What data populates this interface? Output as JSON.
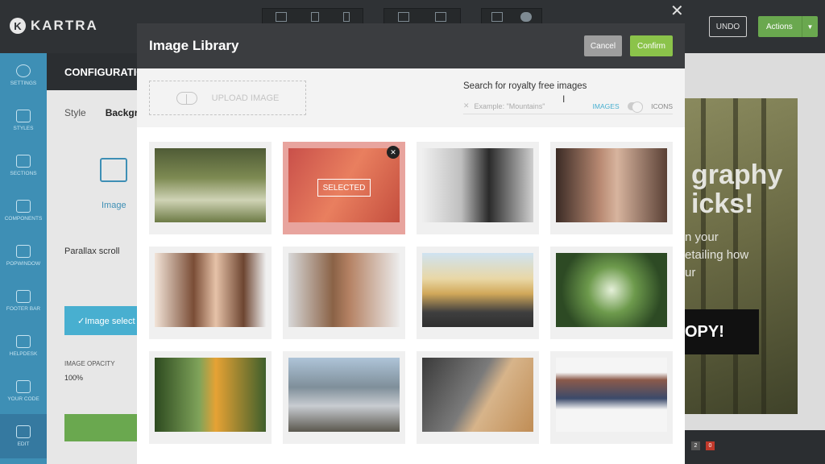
{
  "app": {
    "brand": "KARTRA",
    "undo_label": "UNDO",
    "actions_label": "Actions"
  },
  "left_rail": [
    {
      "label": "SETTINGS",
      "icon": "gear-icon"
    },
    {
      "label": "STYLES",
      "icon": "brush-icon"
    },
    {
      "label": "SECTIONS",
      "icon": "sections-icon"
    },
    {
      "label": "COMPONENTS",
      "icon": "components-icon"
    },
    {
      "label": "POPWINDOW",
      "icon": "popwindow-icon"
    },
    {
      "label": "FOOTER BAR",
      "icon": "footer-bar-icon"
    },
    {
      "label": "HELPDESK",
      "icon": "helpdesk-icon"
    },
    {
      "label": "YOUR CODE",
      "icon": "code-icon"
    },
    {
      "label": "EDIT",
      "icon": "pencil-icon"
    }
  ],
  "config": {
    "title": "CONFIGURATION",
    "tab_style": "Style",
    "tab_background": "Background",
    "image_option": "Image",
    "parallax": "Parallax scroll",
    "image_select_btn": "✓Image select",
    "opacity_label": "IMAGE OPACITY",
    "opacity_value": "100%"
  },
  "modal": {
    "title": "Image Library",
    "cancel": "Cancel",
    "confirm": "Confirm",
    "upload": "UPLOAD IMAGE",
    "search_label": "Search for royalty free images",
    "search_placeholder": "Example: \"Mountains\"",
    "toggle_images": "IMAGES",
    "toggle_icons": "ICONS",
    "selected_label": "SELECTED",
    "images": [
      "forest",
      "canyon",
      "woman-bw",
      "portrait",
      "woman-smile",
      "man-smile",
      "road",
      "trees-up",
      "photographer",
      "mountain",
      "laptop",
      "imac"
    ]
  },
  "preview": {
    "heading_1": "graphy",
    "heading_2": "icks!",
    "text_1": "n your",
    "text_2": "etailing how",
    "text_3": "ur",
    "button": "OPY!",
    "badge_1": "2",
    "badge_2": "0"
  },
  "colors": {
    "accent": "#3e8fb5",
    "confirm": "#8bc34a",
    "selected": "#e8a49e"
  }
}
